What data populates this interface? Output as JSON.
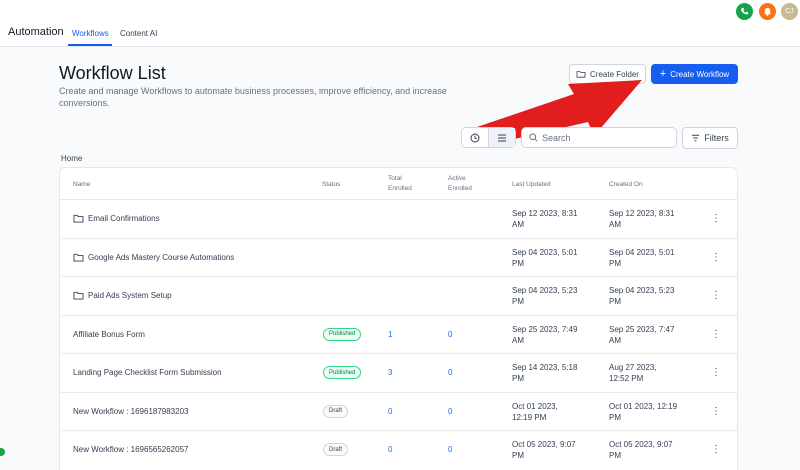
{
  "header": {
    "app_title": "Automation",
    "tabs": [
      {
        "label": "Workflows",
        "active": true
      },
      {
        "label": "Content AI",
        "active": false
      }
    ],
    "avatar_initials": "CJ",
    "icons": [
      "phone-icon",
      "bell-icon"
    ]
  },
  "page": {
    "title": "Workflow List",
    "subtitle": "Create and manage Workflows to automate business processes, improve efficiency, and increase conversions.",
    "create_folder_label": "Create Folder",
    "create_workflow_label": "Create Workflow",
    "search_placeholder": "Search",
    "filters_label": "Filters",
    "breadcrumb": "Home"
  },
  "table": {
    "columns": {
      "name": "Name",
      "status": "Status",
      "total_enrolled": [
        "Total",
        "Enrolled"
      ],
      "active_enrolled": [
        "Active",
        "Enrolled"
      ],
      "last_updated": "Last Updated",
      "created_on": "Created On"
    },
    "rows": [
      {
        "type": "folder",
        "name": "Email Confirmations",
        "status": "",
        "total": "",
        "active": "",
        "updated": [
          "Sep 12 2023, 8:31",
          "AM"
        ],
        "created": [
          "Sep 12 2023, 8:31",
          "AM"
        ]
      },
      {
        "type": "folder",
        "name": "Google Ads Mastery Course Automations",
        "status": "",
        "total": "",
        "active": "",
        "updated": [
          "Sep 04 2023, 5:01",
          "PM"
        ],
        "created": [
          "Sep 04 2023, 5:01",
          "PM"
        ]
      },
      {
        "type": "folder",
        "name": "Paid Ads System Setup",
        "status": "",
        "total": "",
        "active": "",
        "updated": [
          "Sep 04 2023, 5:23",
          "PM"
        ],
        "created": [
          "Sep 04 2023, 5:23",
          "PM"
        ]
      },
      {
        "type": "workflow",
        "name": "Affiliate Bonus Form",
        "status": "Published",
        "total": "1",
        "active": "0",
        "updated": [
          "Sep 25 2023, 7:49",
          "AM"
        ],
        "created": [
          "Sep 25 2023, 7:47",
          "AM"
        ]
      },
      {
        "type": "workflow",
        "name": "Landing Page Checklist Form Submission",
        "status": "Published",
        "total": "3",
        "active": "0",
        "updated": [
          "Sep 14 2023, 5:18",
          "PM"
        ],
        "created": [
          "Aug 27 2023,",
          "12:52 PM"
        ]
      },
      {
        "type": "workflow",
        "name": "New Workflow : 1696187983203",
        "status": "Draft",
        "total": "0",
        "active": "0",
        "updated": [
          "Oct 01 2023,",
          "12:19 PM"
        ],
        "created": [
          "Oct 01 2023, 12:19",
          "PM"
        ]
      },
      {
        "type": "workflow",
        "name": "New Workflow : 1696565262057",
        "status": "Draft",
        "total": "0",
        "active": "0",
        "updated": [
          "Oct 05 2023, 9:07",
          "PM"
        ],
        "created": [
          "Oct 05 2023, 9:07",
          "PM"
        ]
      }
    ]
  },
  "colors": {
    "accent": "#155eef",
    "published": "#32d583",
    "arrow": "#e11d1d"
  }
}
